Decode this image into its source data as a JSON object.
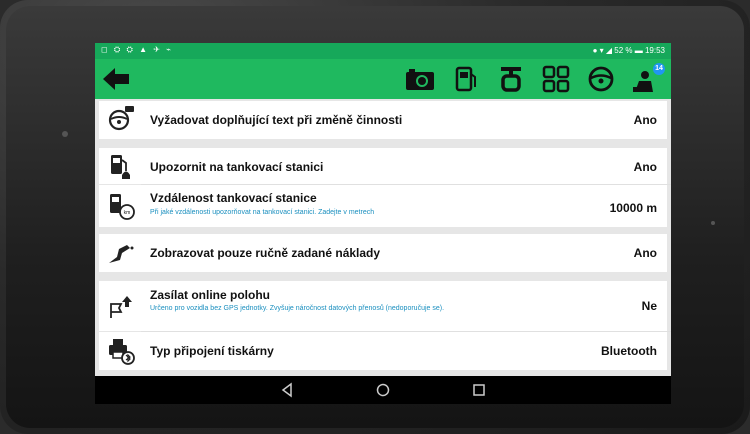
{
  "status_bar": {
    "left_icons": "◻ ⛭ ⛭ ▲ ✈ ⌁",
    "right_text": "52 % ▬ 19:53"
  },
  "toolbar": {
    "badge_count": "14",
    "icons": [
      "back-arrow-icon",
      "camera-icon",
      "fuel-pump-icon",
      "vehicle-front-icon",
      "cargo-icon",
      "steering-wheel-icon",
      "driver-notification-icon"
    ]
  },
  "settings": {
    "row1": {
      "title": "Vyžadovat doplňující text při změně činnosti",
      "value": "Ano"
    },
    "row2": {
      "title": "Upozornit na tankovací stanici",
      "value": "Ano"
    },
    "row3": {
      "title": "Vzdálenost tankovací stanice",
      "subtitle": "Při jaké vzdálenosti upozorňovat na tankovací stanici. Zadejte v metrech",
      "value": "10000 m"
    },
    "row4": {
      "title": "Zobrazovat pouze ručně zadané náklady",
      "value": "Ano"
    },
    "row5": {
      "title": "Zasílat online polohu",
      "subtitle": "Určeno pro vozidla bez GPS jednotky. Zvyšuje náročnost datových přenosů (nedoporučuje se).",
      "value": "Ne"
    },
    "row6": {
      "title": "Typ připojení tiskárny",
      "value": "Bluetooth"
    }
  },
  "colors": {
    "accent": "#1fb95f",
    "status": "#16a85a",
    "subtitle": "#1a8fbf",
    "badge": "#2196f3"
  }
}
